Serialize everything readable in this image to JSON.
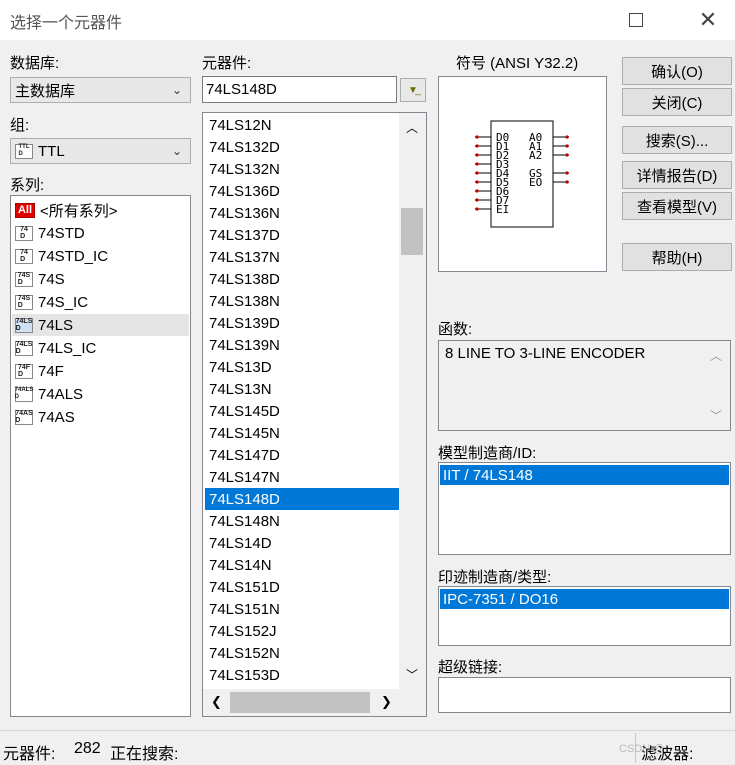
{
  "window": {
    "title": "选择一个元器件"
  },
  "database": {
    "label": "数据库:",
    "value": "主数据库"
  },
  "group": {
    "label": "组:",
    "value": "TTL",
    "icon": "ttl-chip-icon"
  },
  "series": {
    "label": "系列:",
    "items": [
      {
        "label": "<所有系列>",
        "icon": "all-series-icon",
        "badge": "All"
      },
      {
        "label": "74STD",
        "icon": "chip-icon",
        "badge": "74\nD"
      },
      {
        "label": "74STD_IC",
        "icon": "chip-icon",
        "badge": "74\nD"
      },
      {
        "label": "74S",
        "icon": "chip-icon",
        "badge": "74S\nD"
      },
      {
        "label": "74S_IC",
        "icon": "chip-icon",
        "badge": "74S\nD"
      },
      {
        "label": "74LS",
        "icon": "chip-icon",
        "badge": "74LS\nD"
      },
      {
        "label": "74LS_IC",
        "icon": "chip-icon",
        "badge": "74LS\nD"
      },
      {
        "label": "74F",
        "icon": "chip-icon",
        "badge": "74F\nD"
      },
      {
        "label": "74ALS",
        "icon": "chip-icon",
        "badge": "74ALS\nD"
      },
      {
        "label": "74AS",
        "icon": "chip-icon",
        "badge": "74AS\nD"
      }
    ],
    "highlighted_index": 5
  },
  "components": {
    "label": "元器件:",
    "search_value": "74LS148D",
    "items": [
      "74LS12N",
      "74LS132D",
      "74LS132N",
      "74LS136D",
      "74LS136N",
      "74LS137D",
      "74LS137N",
      "74LS138D",
      "74LS138N",
      "74LS139D",
      "74LS139N",
      "74LS13D",
      "74LS13N",
      "74LS145D",
      "74LS145N",
      "74LS147D",
      "74LS147N",
      "74LS148D",
      "74LS148N",
      "74LS14D",
      "74LS14N",
      "74LS151D",
      "74LS151N",
      "74LS152J",
      "74LS152N",
      "74LS153D"
    ],
    "selected_index": 17
  },
  "symbol": {
    "label": "符号 (ANSI Y32.2)",
    "left_pins": [
      "D0",
      "D1",
      "D2",
      "D3",
      "D4",
      "D5",
      "D6",
      "D7",
      "EI"
    ],
    "right_pins_top": [
      "A0",
      "A1",
      "A2"
    ],
    "right_pins_bottom": [
      "GS",
      "EO"
    ]
  },
  "buttons": {
    "ok": "确认(O)",
    "close": "关闭(C)",
    "search": "搜索(S)...",
    "detail_report": "详情报告(D)",
    "view_model": "查看模型(V)",
    "help": "帮助(H)"
  },
  "function": {
    "label": "函数:",
    "value": "8 LINE TO 3-LINE ENCODER"
  },
  "model_manufacturer": {
    "label": "模型制造商/ID:",
    "selected": "IIT / 74LS148"
  },
  "footprint_manufacturer": {
    "label": "印迹制造商/类型:",
    "selected": "IPC-7351 / DO16"
  },
  "hyperlink": {
    "label": "超级链接:",
    "value": ""
  },
  "status": {
    "count_label": "元器件:",
    "count": "282",
    "searching": "正在搜索:",
    "filter": "滤波器:",
    "watermark": "CSDN @"
  },
  "colors": {
    "selection": "#0078d7",
    "all_badge": "#e00000"
  }
}
